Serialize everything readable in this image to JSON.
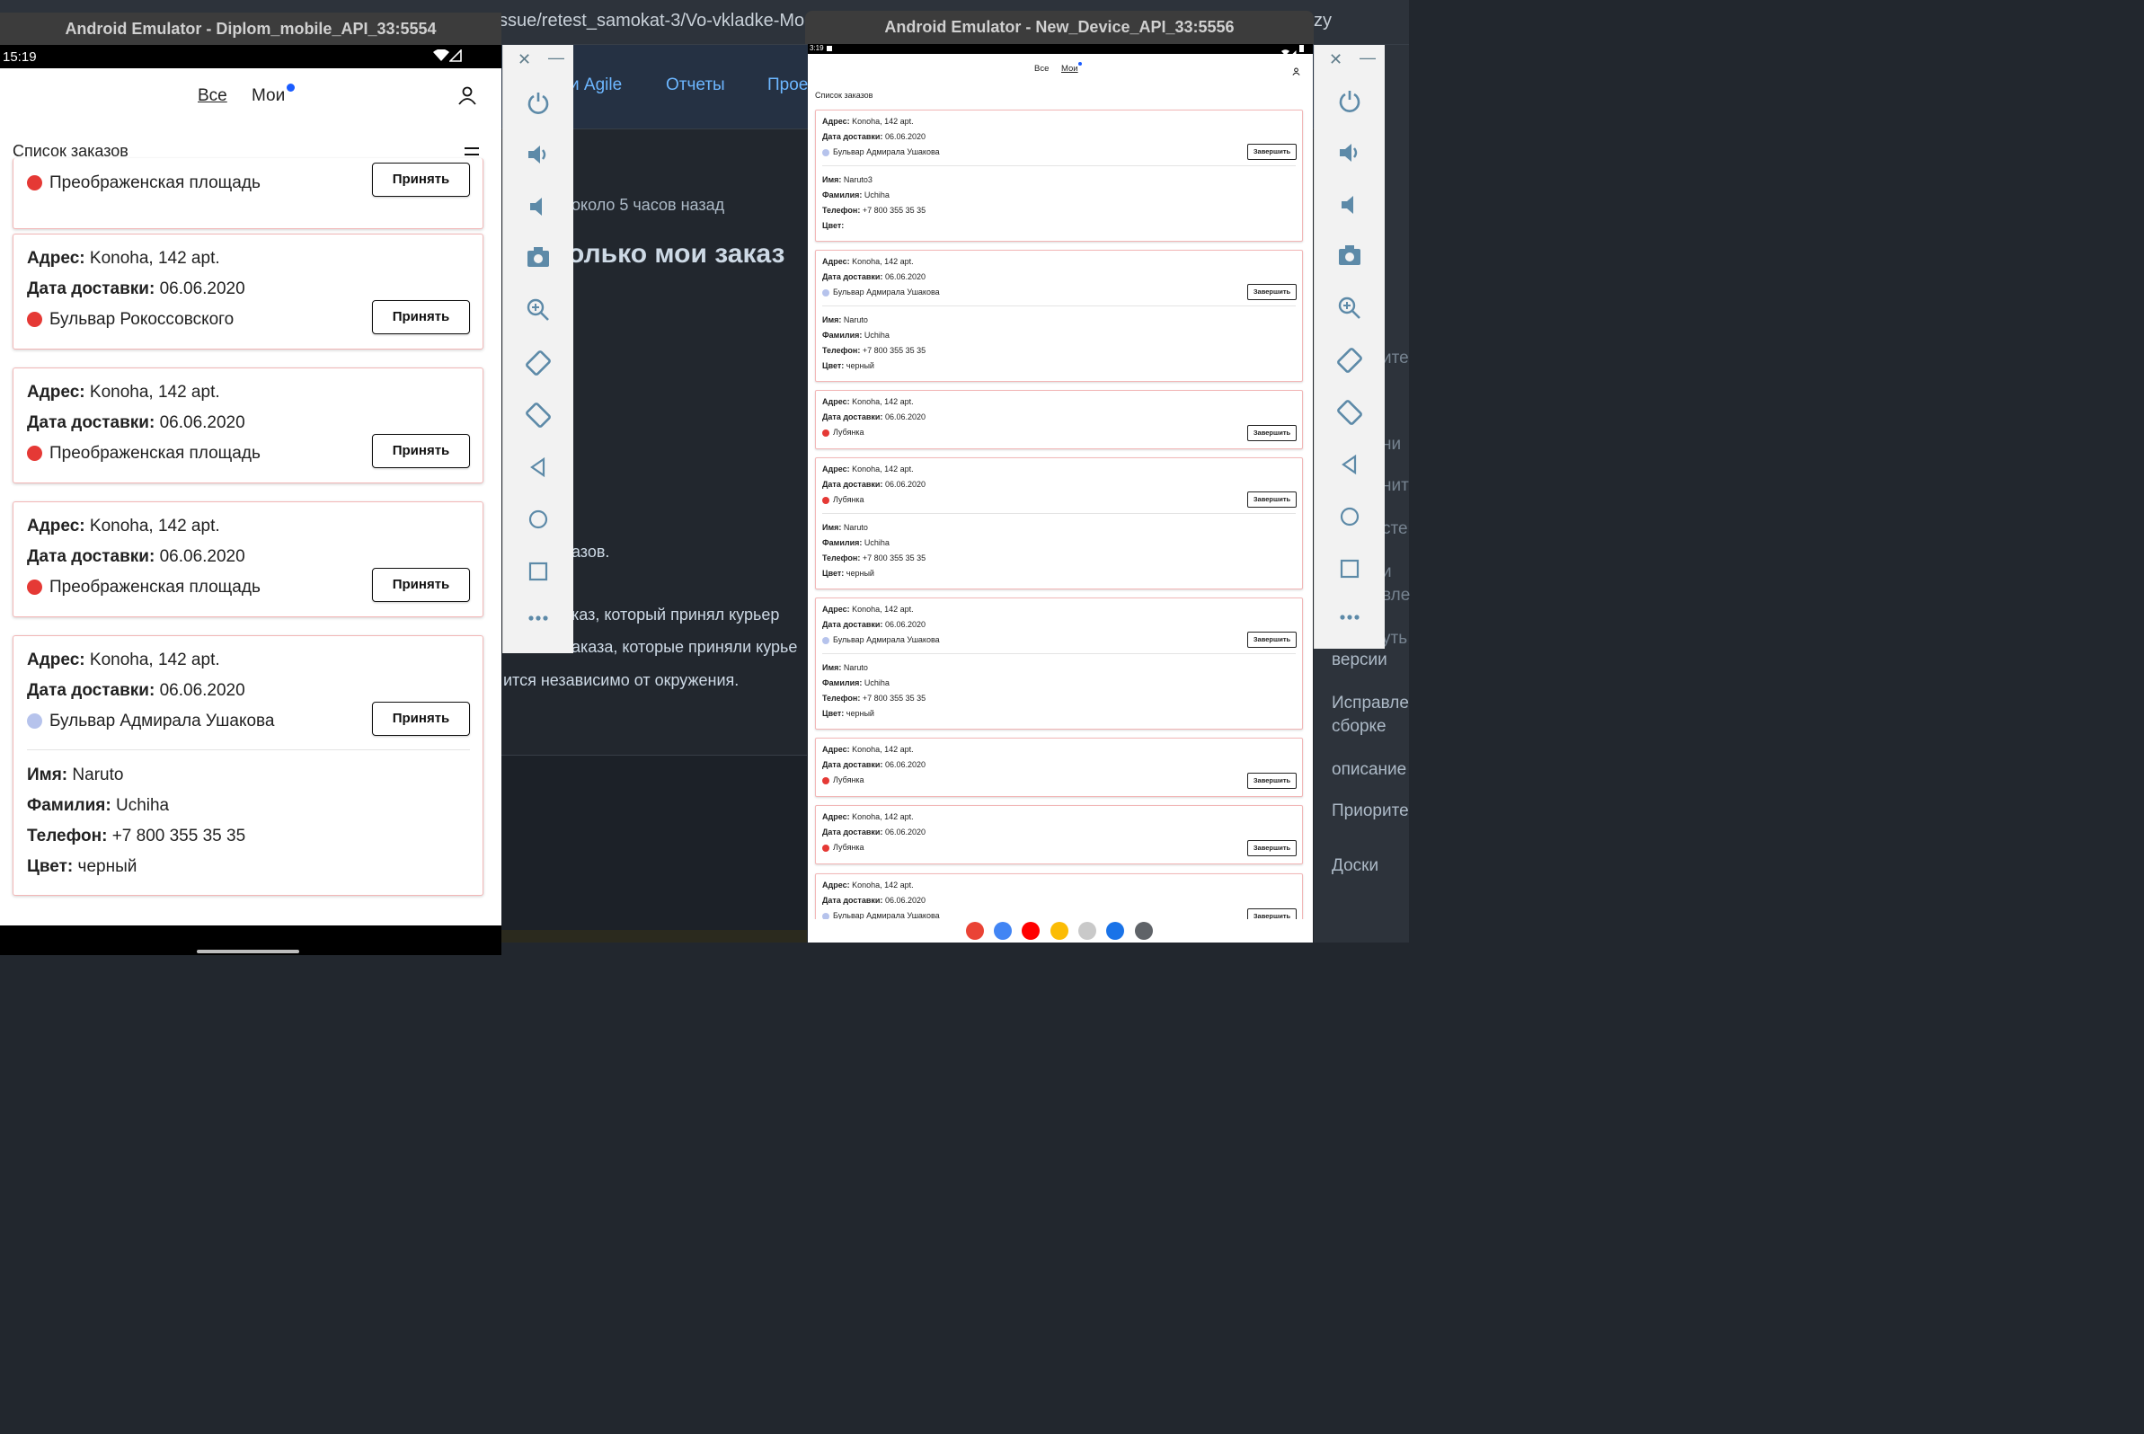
{
  "browser": {
    "url": "ssue/retest_samokat-3/Vo-vkladke-Mo",
    "url_tail": "zy",
    "nav": [
      "и Agile",
      "Отчеты",
      "Прое"
    ],
    "time_ago": "около 5 часов назад",
    "heading": "олько мои заказ",
    "line1": "азов.",
    "line2": "каз, который принял курьер",
    "line3": "аказа, которые приняли курье",
    "line4": "ится независимо от окружения.",
    "sidebar": [
      "ите",
      "ни",
      "нит",
      "сте",
      "и",
      "вле",
      "уть",
      "версии",
      "Исправле",
      "сборке",
      "описание",
      "Приорите",
      "Доски"
    ]
  },
  "emu1": {
    "title": "Android Emulator - Diplom_mobile_API_33:5554",
    "time": "15:19",
    "tabs": {
      "all": "Все",
      "mine": "Мои"
    },
    "list_title": "Список заказов",
    "labels": {
      "address": "Адрес:",
      "date": "Дата доставки:",
      "name": "Имя:",
      "surname": "Фамилия:",
      "phone": "Телефон:",
      "color": "Цвет:"
    },
    "accept": "Принять",
    "partial_card": {
      "station": "Преображенская площадь"
    },
    "cards": [
      {
        "address": "Konoha, 142 apt.",
        "date": "06.06.2020",
        "station": "Бульвар Рокоссовского",
        "dot": "#e53935"
      },
      {
        "address": "Konoha, 142 apt.",
        "date": "06.06.2020",
        "station": "Преображенская площадь",
        "dot": "#e53935"
      },
      {
        "address": "Konoha, 142 apt.",
        "date": "06.06.2020",
        "station": "Преображенская площадь",
        "dot": "#e53935"
      },
      {
        "address": "Konoha, 142 apt.",
        "date": "06.06.2020",
        "station": "Бульвар Адмирала Ушакова",
        "dot": "#b6c3ec",
        "name": "Naruto",
        "surname": "Uchiha",
        "phone": "+7 800 355 35 35",
        "color": "черный"
      }
    ]
  },
  "emu2": {
    "title": "Android Emulator - New_Device_API_33:5556",
    "time": "3:19",
    "tabs": {
      "all": "Все",
      "mine": "Мои"
    },
    "list_title": "Список заказов",
    "labels": {
      "address": "Адрес:",
      "date": "Дата доставки:",
      "name": "Имя:",
      "surname": "Фамилия:",
      "phone": "Телефон:",
      "color": "Цвет:"
    },
    "finish": "Завершить",
    "cards": [
      {
        "address": "Konoha, 142 apt.",
        "date": "06.06.2020",
        "station": "Бульвар Адмирала Ушакова",
        "dot": "#b6c3ec",
        "name": "Naruto3",
        "surname": "Uchiha",
        "phone": "+7 800 355 35 35",
        "color": ""
      },
      {
        "address": "Konoha, 142 apt.",
        "date": "06.06.2020",
        "station": "Бульвар Адмирала Ушакова",
        "dot": "#b6c3ec",
        "name": "Naruto",
        "surname": "Uchiha",
        "phone": "+7 800 355 35 35",
        "color": "черный"
      },
      {
        "address": "Konoha, 142 apt.",
        "date": "06.06.2020",
        "station": "Лубянка",
        "dot": "#e53935"
      },
      {
        "address": "Konoha, 142 apt.",
        "date": "06.06.2020",
        "station": "Лубянка",
        "dot": "#e53935",
        "name": "Naruto",
        "surname": "Uchiha",
        "phone": "+7 800 355 35 35",
        "color": "черный"
      },
      {
        "address": "Konoha, 142 apt.",
        "date": "06.06.2020",
        "station": "Бульвар Адмирала Ушакова",
        "dot": "#b6c3ec",
        "name": "Naruto",
        "surname": "Uchiha",
        "phone": "+7 800 355 35 35",
        "color": "черный"
      },
      {
        "address": "Konoha, 142 apt.",
        "date": "06.06.2020",
        "station": "Лубянка",
        "dot": "#e53935"
      },
      {
        "address": "Konoha, 142 apt.",
        "date": "06.06.2020",
        "station": "Лубянка",
        "dot": "#e53935"
      },
      {
        "address": "Konoha, 142 apt.",
        "date": "06.06.2020",
        "station": "Бульвар Адмирала Ушакова",
        "dot": "#b6c3ec"
      }
    ]
  },
  "toolbar": {
    "close": "✕",
    "minimize": "—",
    "buttons": [
      "power-icon",
      "volume-up-icon",
      "volume-down-icon",
      "camera-icon",
      "zoom-icon",
      "rotate-left-icon",
      "rotate-right-icon",
      "back-icon",
      "home-icon",
      "overview-icon",
      "more-icon"
    ]
  },
  "taskbar": {
    "apps": [
      "gmail-icon",
      "chrome-icon",
      "youtube-icon",
      "photos-icon",
      "camera-app-icon",
      "messages-icon",
      "app-drawer-icon"
    ],
    "app_colors": [
      "#ea4335",
      "#4285f4",
      "#ff0000",
      "#fbbc05",
      "#c9c9c9",
      "#1a73e8",
      "#5f6368"
    ]
  }
}
